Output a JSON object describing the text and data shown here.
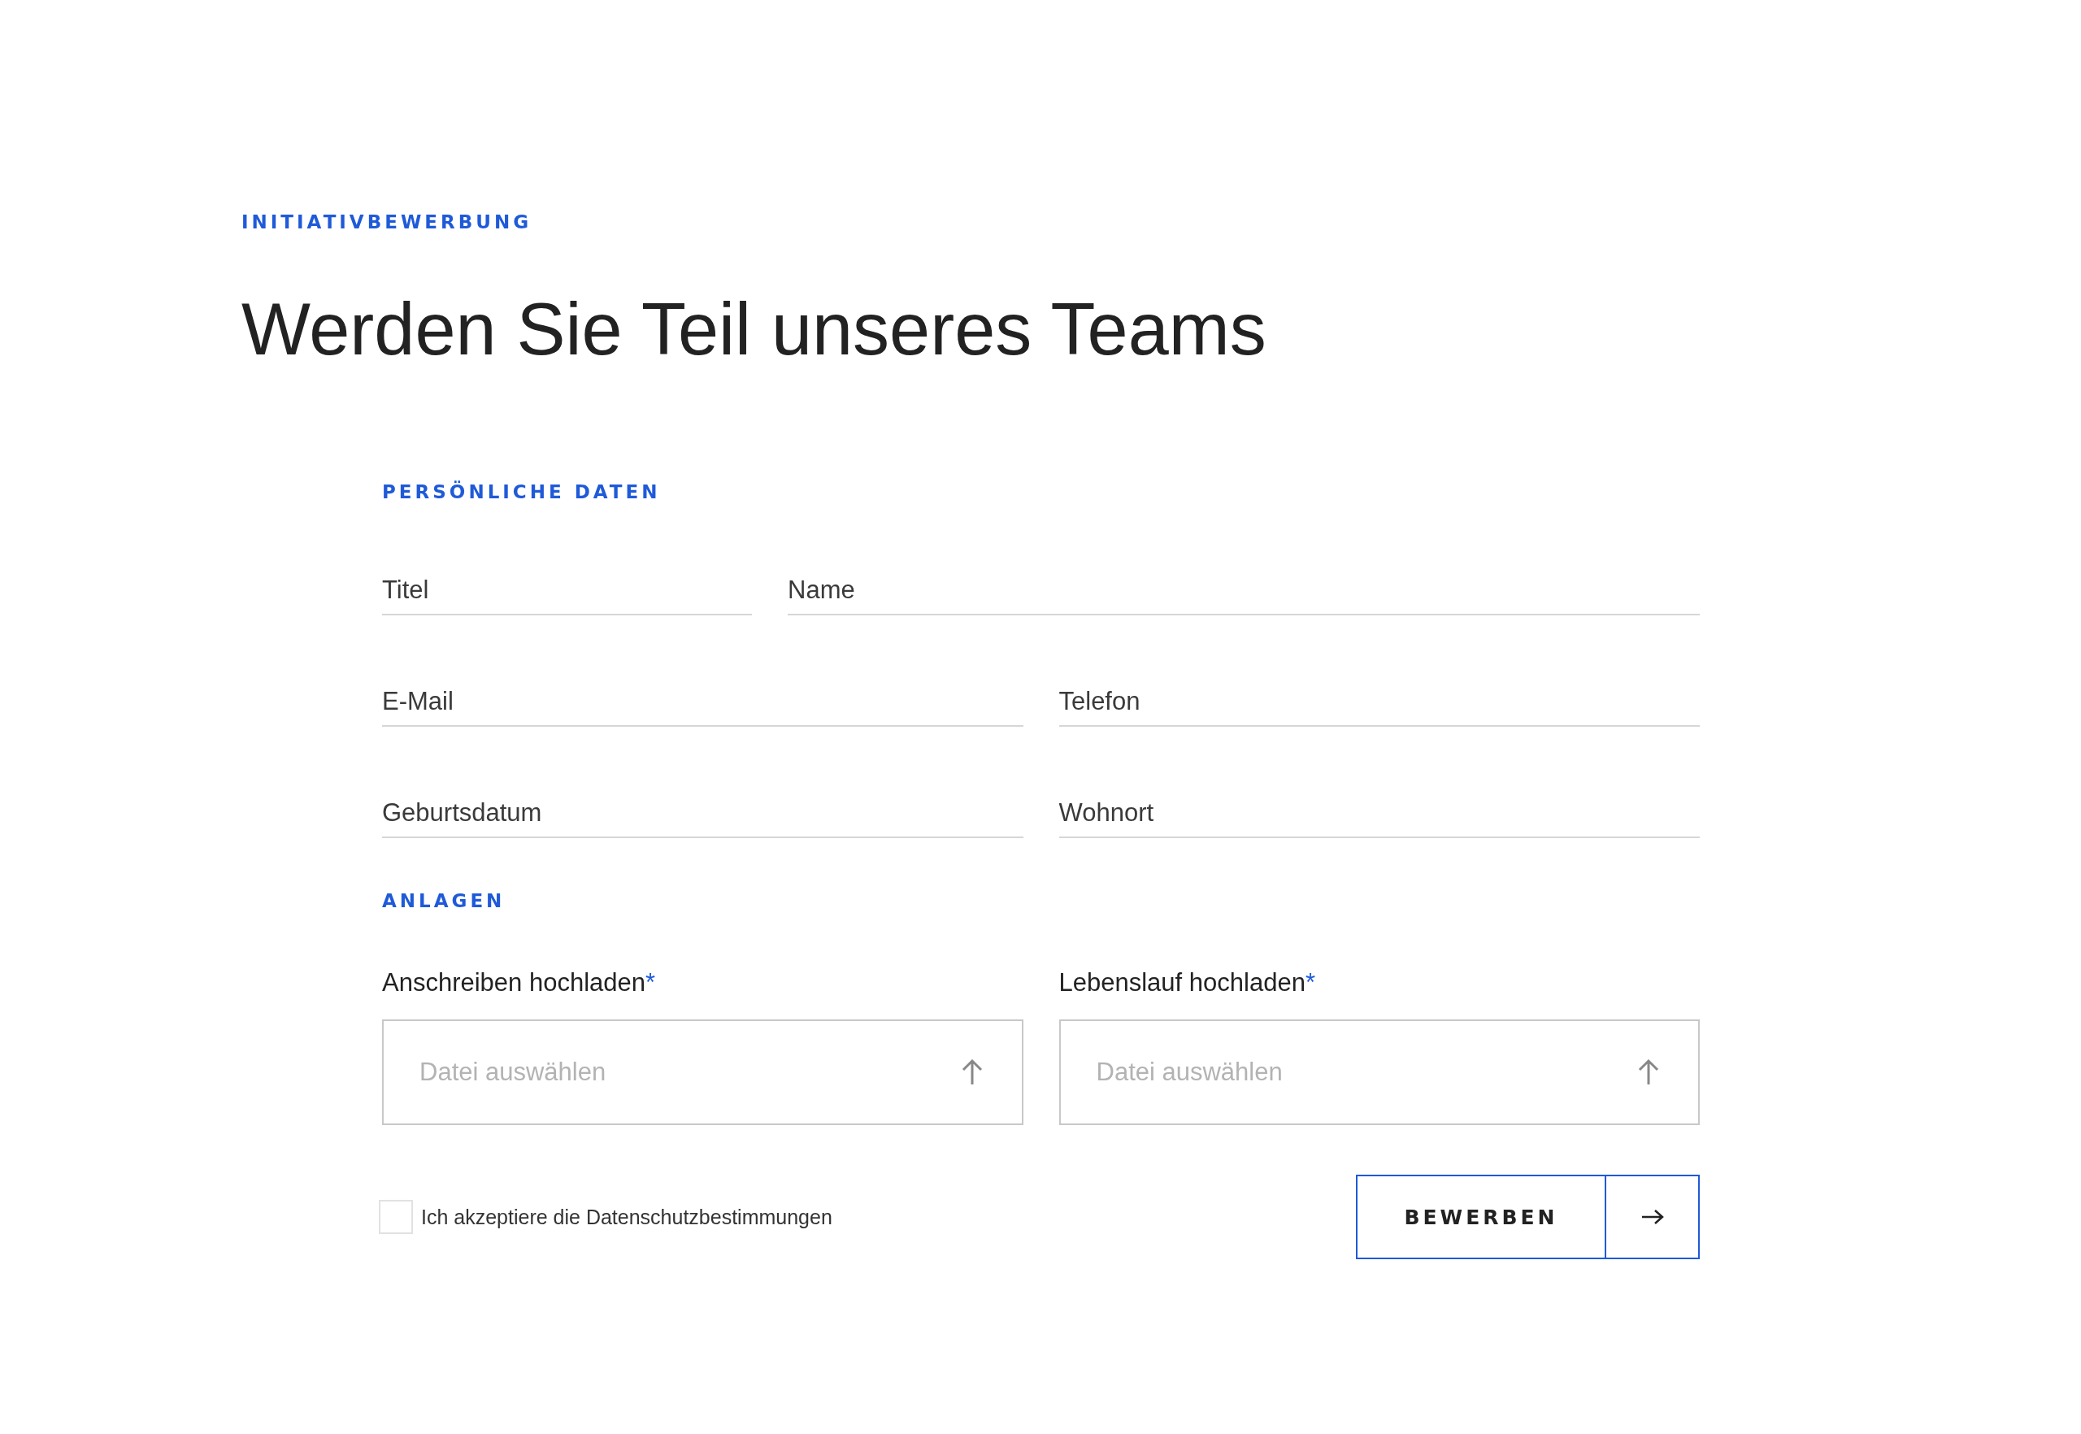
{
  "eyebrow": "INITIATIVBEWERBUNG",
  "title": "Werden Sie Teil unseres Teams",
  "personal": {
    "heading": "PERSÖNLICHE DATEN",
    "rows": [
      {
        "fields": [
          {
            "placeholder": "Titel"
          },
          {
            "placeholder": "Name"
          }
        ]
      },
      {
        "fields": [
          {
            "placeholder": "E-Mail"
          },
          {
            "placeholder": "Telefon"
          }
        ]
      },
      {
        "fields": [
          {
            "placeholder": "Geburtsdatum"
          },
          {
            "placeholder": "Wohnort"
          }
        ]
      }
    ]
  },
  "attachments": {
    "heading": "ANLAGEN",
    "uploads": [
      {
        "label": "Anschreiben hochladen",
        "mark": "*",
        "placeholder": "Datei auswählen"
      },
      {
        "label": "Lebenslauf hochladen",
        "mark": "*",
        "placeholder": "Datei auswählen"
      }
    ]
  },
  "consent": {
    "label": "Ich akzeptiere die Datenschutzbestimmungen",
    "checked": false
  },
  "submit": {
    "label": "BEWERBEN"
  }
}
